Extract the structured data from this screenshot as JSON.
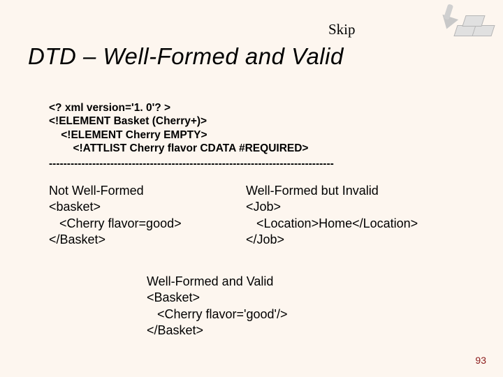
{
  "skip": "Skip",
  "title": "DTD – Well-Formed and Valid",
  "dtd": {
    "l1": "<? xml version='1. 0'? >",
    "l2": "<!ELEMENT Basket (Cherry+)>",
    "l3": "    <!ELEMENT Cherry EMPTY>",
    "l4": "        <!ATTLIST Cherry flavor CDATA #REQUIRED>"
  },
  "divider": "-------------------------------------------------------------------------------",
  "ex_left": {
    "h": "Not Well-Formed",
    "l1": "<basket>",
    "l2": "   <Cherry flavor=good>",
    "l3": "</Basket>"
  },
  "ex_right": {
    "h": "Well-Formed but Invalid",
    "l1": "<Job>",
    "l2": "   <Location>Home</Location>",
    "l3": "</Job>"
  },
  "ex_bottom": {
    "h": "Well-Formed and Valid",
    "l1": "<Basket>",
    "l2": "   <Cherry flavor='good'/>",
    "l3": "</Basket>"
  },
  "page": "93"
}
